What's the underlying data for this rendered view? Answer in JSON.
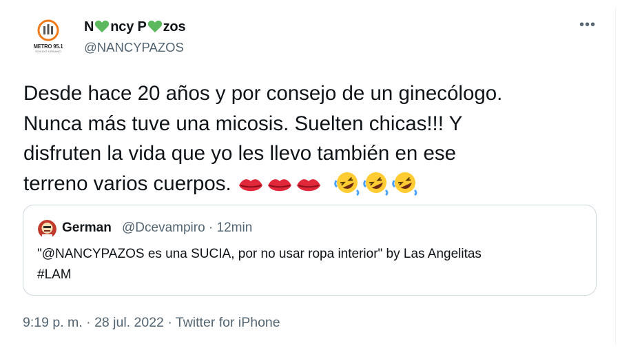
{
  "author": {
    "display_name_parts": [
      "N",
      "ncy P",
      "zos"
    ],
    "handle": "@NANCYPAZOS",
    "avatar_brand_line1": "METRO 95.1",
    "avatar_brand_line2": "SONIDO URBANO",
    "name_emoji": "green-heart-icon"
  },
  "more_label": "•••",
  "tweet": {
    "lines": [
      "Desde hace 20 años y por consejo de un ginecólogo.",
      "Nunca más tuve una micosis. Suelten chicas!!! Y",
      "disfruten la vida que yo les llevo también en ese",
      "terreno varios cuerpos."
    ],
    "emojis": [
      "kiss-lips-icon",
      "kiss-lips-icon",
      "kiss-lips-icon",
      "rolling-laughing-icon",
      "rolling-laughing-icon",
      "rolling-laughing-icon"
    ]
  },
  "quote": {
    "name": "German",
    "meta": "@Dcevampiro · 12min",
    "text_line1": "\"@NANCYPAZOS es una SUCIA, por no usar ropa interior\" by Las Angelitas",
    "text_line2": "#LAM"
  },
  "footer": {
    "time": "9:19 p. m.",
    "sep1": " · ",
    "date": "28 jul. 2022",
    "sep2": " · ",
    "source": "Twitter for iPhone"
  },
  "colors": {
    "text": "#0f1419",
    "secondary": "#536471",
    "border": "#cfd9de",
    "heart": "#5cb85c",
    "brand_orange": "#f07a1a"
  }
}
